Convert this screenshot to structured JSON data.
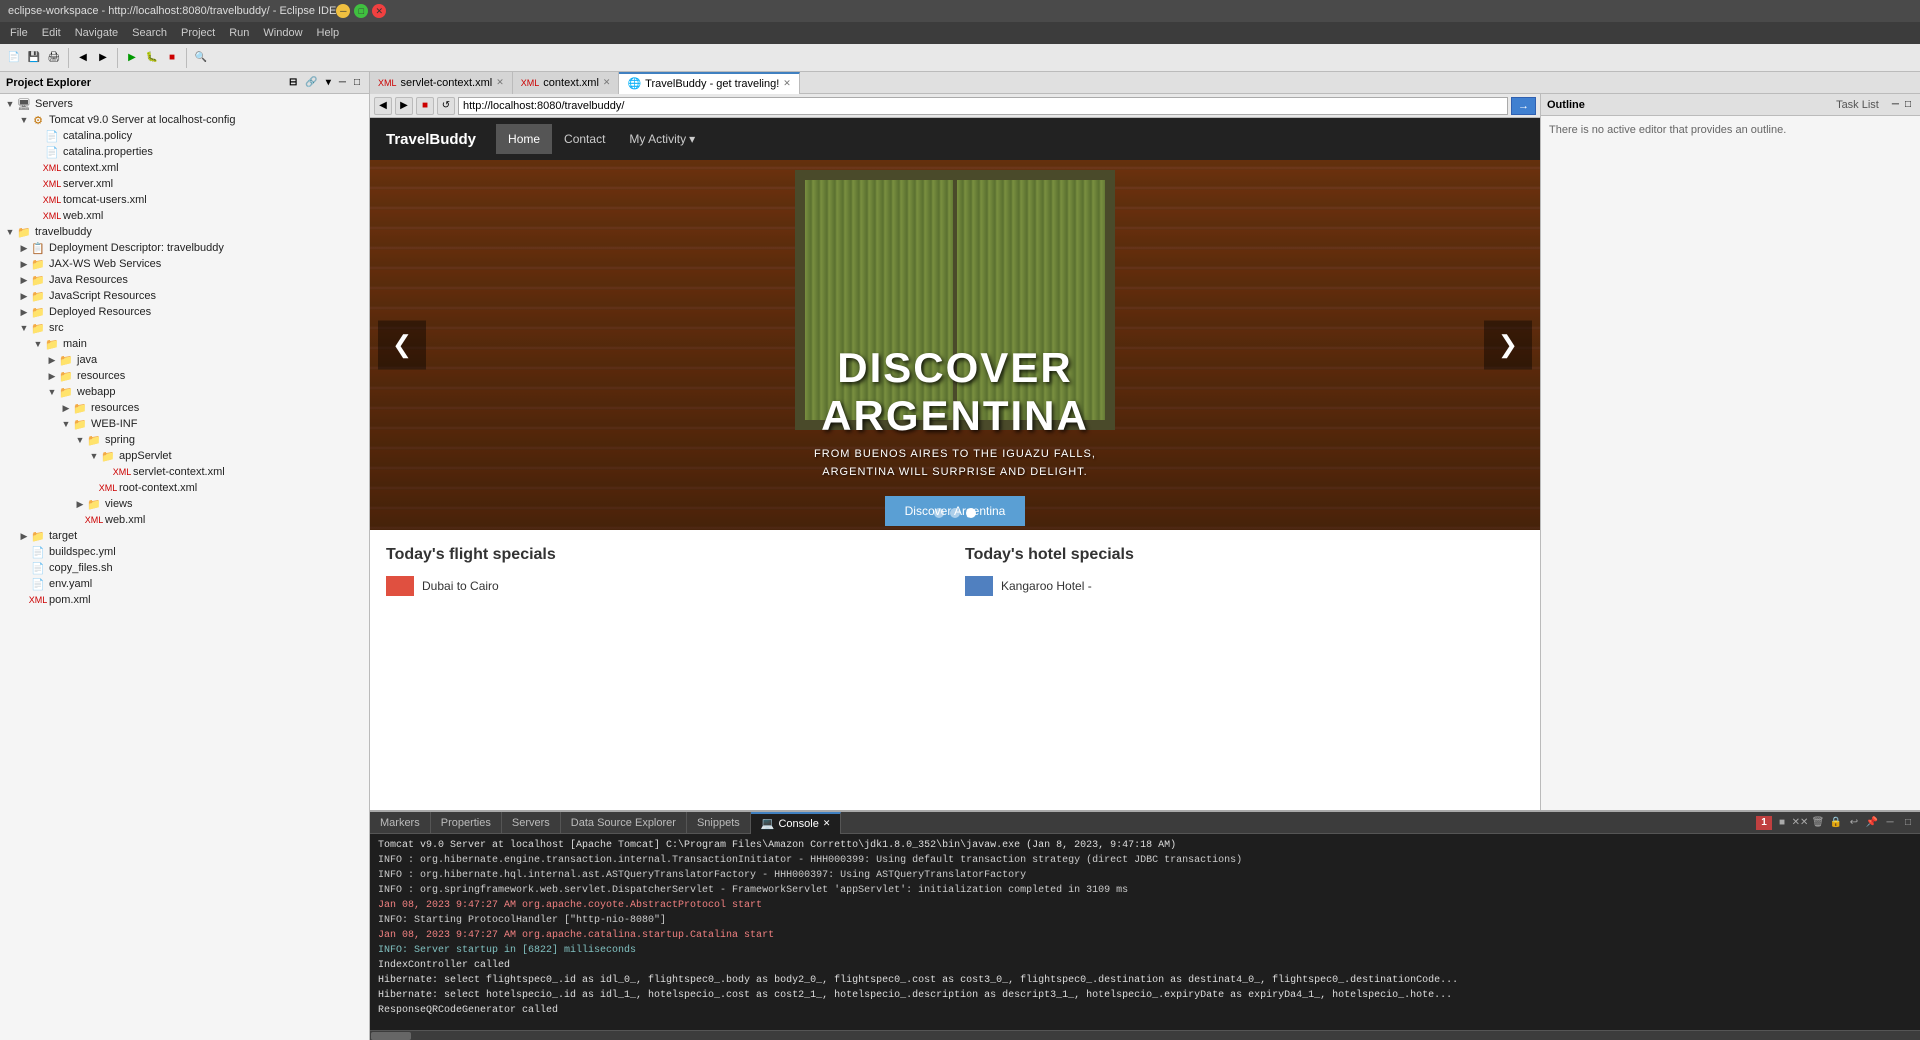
{
  "titlebar": {
    "title": "eclipse-workspace - http://localhost:8080/travelbuddy/ - Eclipse IDE",
    "min": "─",
    "max": "□",
    "close": "✕"
  },
  "menubar": {
    "items": [
      "File",
      "Edit",
      "Navigate",
      "Search",
      "Project",
      "Run",
      "Window",
      "Help"
    ]
  },
  "left_panel": {
    "title": "Project Explorer",
    "close_icon": "✕"
  },
  "tree": {
    "items": [
      {
        "label": "Servers",
        "level": 0,
        "type": "folder",
        "expanded": true
      },
      {
        "label": "Tomcat v9.0 Server at localhost-config",
        "level": 1,
        "type": "server",
        "expanded": true
      },
      {
        "label": "catalina.policy",
        "level": 2,
        "type": "file"
      },
      {
        "label": "catalina.properties",
        "level": 2,
        "type": "file"
      },
      {
        "label": "context.xml",
        "level": 2,
        "type": "xml"
      },
      {
        "label": "server.xml",
        "level": 2,
        "type": "xml"
      },
      {
        "label": "tomcat-users.xml",
        "level": 2,
        "type": "xml"
      },
      {
        "label": "web.xml",
        "level": 2,
        "type": "xml"
      },
      {
        "label": "travelbuddy",
        "level": 0,
        "type": "project",
        "expanded": true
      },
      {
        "label": "Deployment Descriptor: travelbuddy",
        "level": 1,
        "type": "deploy"
      },
      {
        "label": "JAX-WS Web Services",
        "level": 1,
        "type": "folder"
      },
      {
        "label": "Java Resources",
        "level": 1,
        "type": "folder"
      },
      {
        "label": "JavaScript Resources",
        "level": 1,
        "type": "folder"
      },
      {
        "label": "Deployed Resources",
        "level": 1,
        "type": "folder"
      },
      {
        "label": "src",
        "level": 1,
        "type": "folder",
        "expanded": true
      },
      {
        "label": "main",
        "level": 2,
        "type": "folder",
        "expanded": true
      },
      {
        "label": "java",
        "level": 3,
        "type": "folder"
      },
      {
        "label": "resources",
        "level": 3,
        "type": "folder"
      },
      {
        "label": "webapp",
        "level": 3,
        "type": "folder",
        "expanded": true
      },
      {
        "label": "resources",
        "level": 4,
        "type": "folder"
      },
      {
        "label": "WEB-INF",
        "level": 4,
        "type": "folder",
        "expanded": true
      },
      {
        "label": "spring",
        "level": 5,
        "type": "folder",
        "expanded": true
      },
      {
        "label": "appServlet",
        "level": 6,
        "type": "folder",
        "expanded": true
      },
      {
        "label": "servlet-context.xml",
        "level": 7,
        "type": "xml"
      },
      {
        "label": "root-context.xml",
        "level": 6,
        "type": "xml"
      },
      {
        "label": "views",
        "level": 5,
        "type": "folder"
      },
      {
        "label": "web.xml",
        "level": 5,
        "type": "xml"
      },
      {
        "label": "target",
        "level": 1,
        "type": "folder"
      },
      {
        "label": "buildspec.yml",
        "level": 1,
        "type": "file"
      },
      {
        "label": "copy_files.sh",
        "level": 1,
        "type": "file"
      },
      {
        "label": "env.yaml",
        "level": 1,
        "type": "file"
      },
      {
        "label": "pom.xml",
        "level": 1,
        "type": "xml"
      }
    ]
  },
  "tabs": [
    {
      "label": "servlet-context.xml",
      "icon": "xml",
      "active": false
    },
    {
      "label": "context.xml",
      "icon": "xml",
      "active": false
    },
    {
      "label": "TravelBuddy - get traveling!",
      "icon": "web",
      "active": true
    }
  ],
  "browser": {
    "url": "http://localhost:8080/travelbuddy/",
    "back": "◀",
    "forward": "▶",
    "stop": "■",
    "refresh": "↺"
  },
  "travel_site": {
    "brand": "TravelBuddy",
    "nav_links": [
      "Home",
      "Contact",
      "My Activity ▾"
    ],
    "nav_active": "Home",
    "hero": {
      "title_line1": "DISCOVER",
      "title_line2": "ARGENTINA",
      "subtitle_line1": "FROM BUENOS AIRES TO THE IGUAZU FALLS,",
      "subtitle_line2": "ARGENTINA WILL SURPRISE AND DELIGHT.",
      "btn_label": "Discover Argentina",
      "dots": 3,
      "active_dot": 2
    },
    "specials": {
      "flights_title": "Today's flight specials",
      "hotels_title": "Today's hotel specials",
      "flight_item": {
        "color": "#e05040",
        "name": "Dubai to Cairo"
      },
      "hotel_item": {
        "color": "#5080c0",
        "name": "Kangaroo Hotel -"
      }
    }
  },
  "outline": {
    "title": "Outline",
    "task_list_title": "Task List",
    "no_outline_text": "There is no active editor that provides an outline."
  },
  "bottom_tabs": [
    {
      "label": "Markers"
    },
    {
      "label": "Properties"
    },
    {
      "label": "Servers"
    },
    {
      "label": "Data Source Explorer"
    },
    {
      "label": "Snippets"
    },
    {
      "label": "Console",
      "active": true,
      "closeable": true
    }
  ],
  "console": {
    "header": "Tomcat v9.0 Server at localhost [Apache Tomcat] C:\\Program Files\\Amazon Corretto\\jdk1.8.0_352\\bin\\javaw.exe (Jan 8, 2023, 9:47:18 AM)",
    "lines": [
      {
        "type": "info",
        "text": "INFO : org.hibernate.engine.transaction.internal.TransactionInitiator - HHH000399: Using default transaction strategy (direct JDBC transactions)"
      },
      {
        "type": "info",
        "text": "INFO : org.hibernate.hql.internal.ast.ASTQueryTranslatorFactory - HHH000397: Using ASTQueryTranslatorFactory"
      },
      {
        "type": "info",
        "text": "INFO : org.springframework.web.servlet.DispatcherServlet - FrameworkServlet 'appServlet': initialization completed in 3109 ms"
      },
      {
        "type": "red",
        "text": "Jan 08, 2023 9:47:27 AM org.apache.coyote.AbstractProtocol start"
      },
      {
        "type": "info",
        "text": "INFO: Starting ProtocolHandler [\"http-nio-8080\"]"
      },
      {
        "type": "red",
        "text": "Jan 08, 2023 9:47:27 AM org.apache.catalina.startup.Catalina start"
      },
      {
        "type": "teal",
        "text": "INFO: Server startup in [6822] milliseconds"
      },
      {
        "type": "normal",
        "text": "IndexController called"
      },
      {
        "type": "normal",
        "text": "Hibernate: select flightspec0_.id as idl_0_, flightspec0_.body as body2_0_, flightspec0_.cost as cost3_0_, flightspec0_.destination as destinat4_0_, flightspec0_.destinationCode..."
      },
      {
        "type": "normal",
        "text": "Hibernate: select hotelspecio_.id as idl_1_, hotelspecio_.cost as cost2_1_, hotelspecio_.description as descript3_1_, hotelspecio_.expiryDate as expiryDa4_1_, hotelspecio_.hote..."
      },
      {
        "type": "normal",
        "text": "ResponseQRCodeGenerator called"
      }
    ]
  },
  "counter_badge": "1"
}
